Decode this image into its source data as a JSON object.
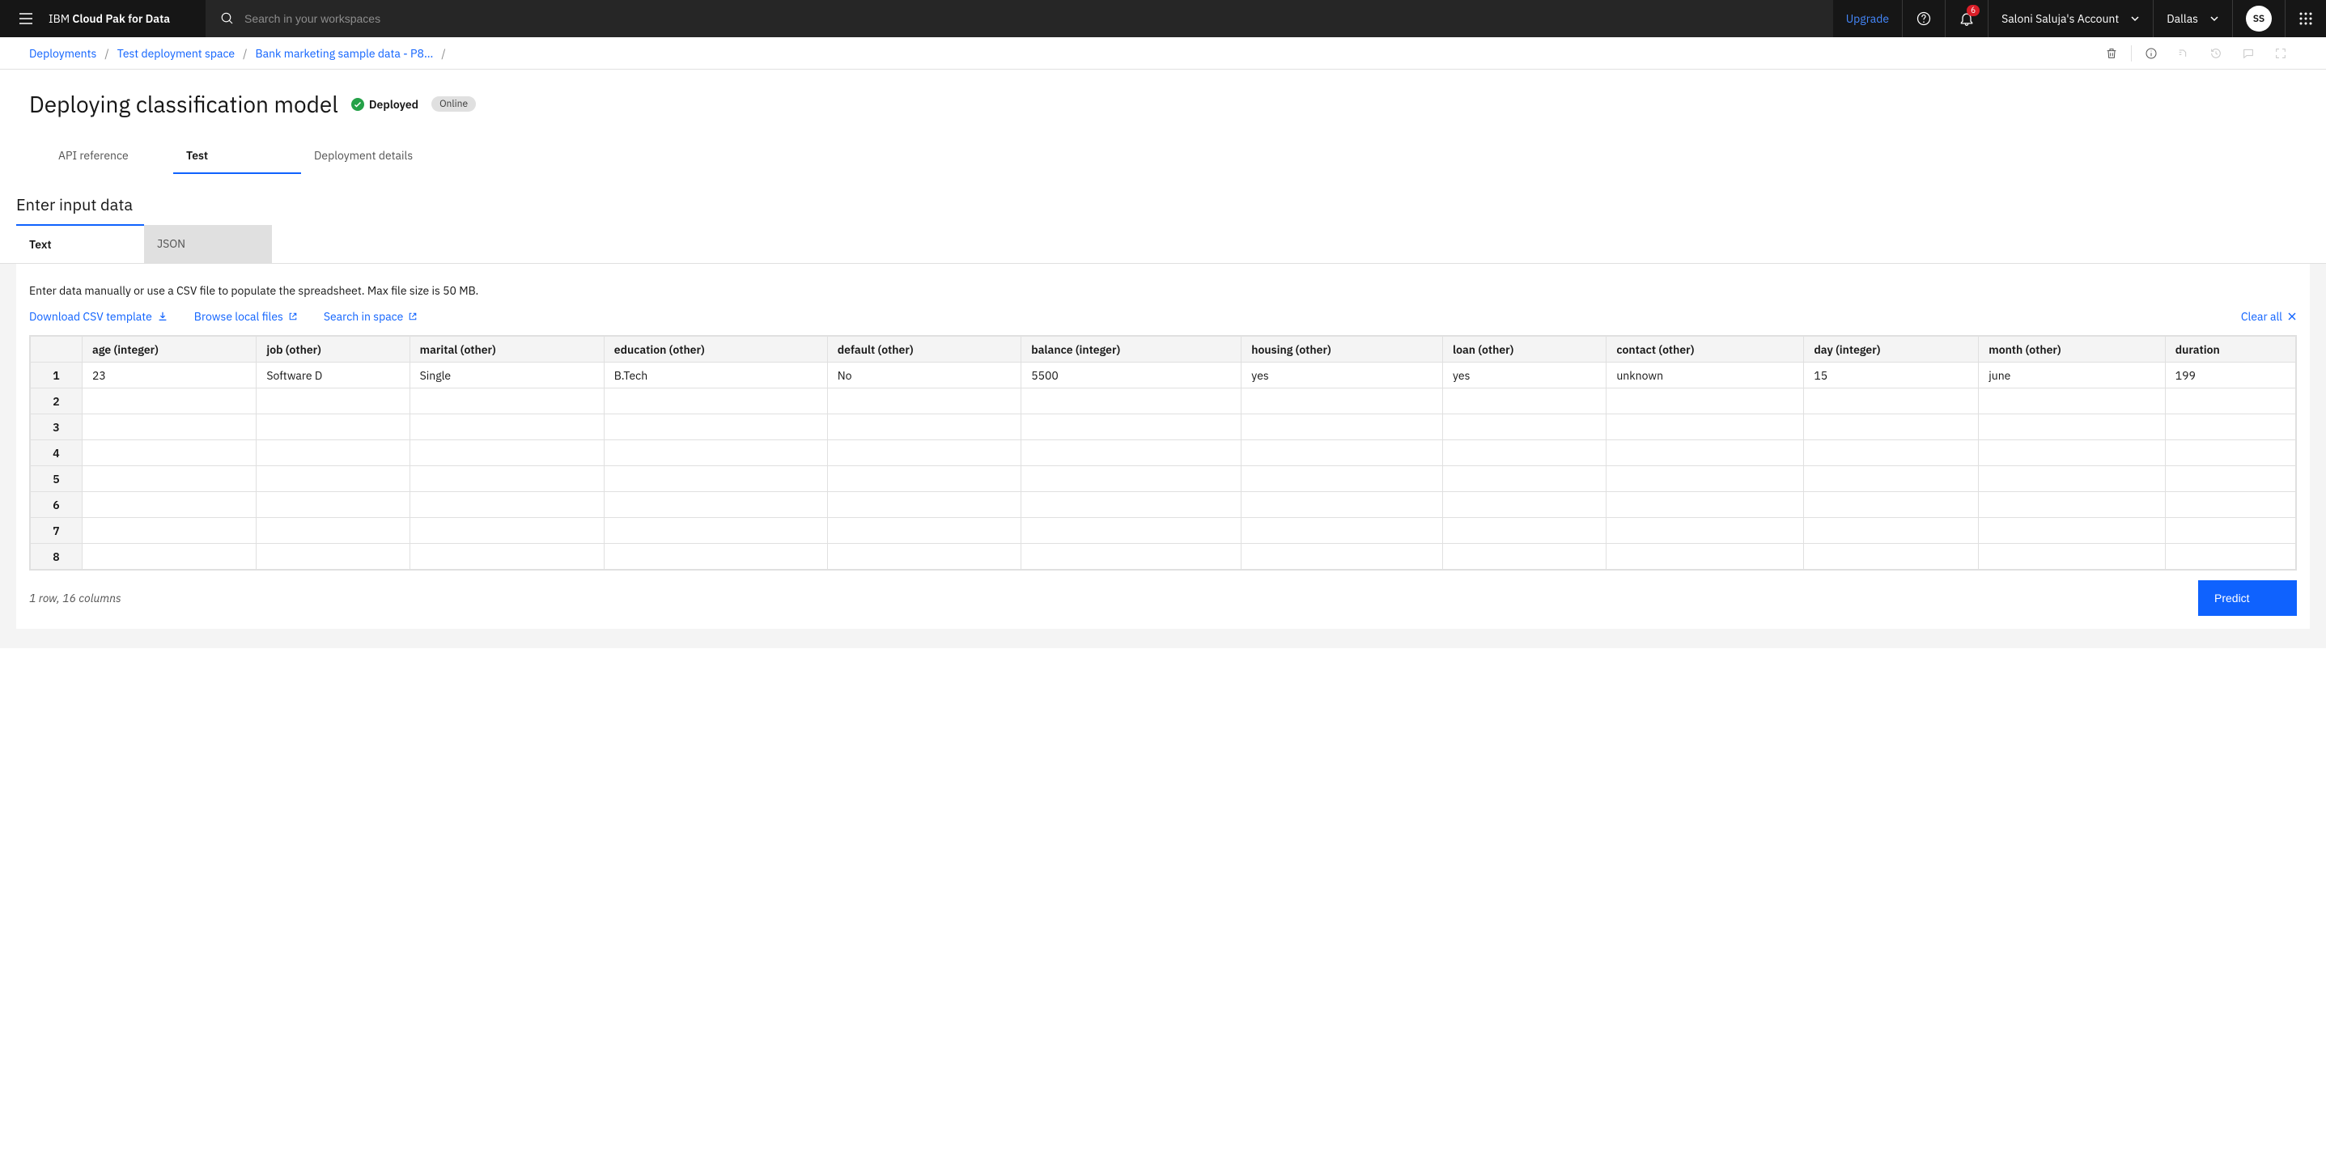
{
  "brand": {
    "prefix": "IBM ",
    "bold": "Cloud Pak for Data"
  },
  "search": {
    "placeholder": "Search in your workspaces"
  },
  "topbar": {
    "upgrade": "Upgrade",
    "notifications_count": "6",
    "account_label": "Saloni Saluja's Account",
    "region": "Dallas",
    "avatar_initials": "SS"
  },
  "breadcrumbs": [
    "Deployments",
    "Test deployment space",
    "Bank marketing sample data - P8..."
  ],
  "page": {
    "title": "Deploying classification model",
    "status": "Deployed",
    "badge": "Online"
  },
  "mainTabs": {
    "api": "API reference",
    "test": "Test",
    "details": "Deployment details"
  },
  "section_title": "Enter input data",
  "inputTabs": {
    "text": "Text",
    "json": "JSON"
  },
  "instruction": "Enter data manually or use a CSV file to populate the spreadsheet. Max file size is 50 MB.",
  "links": {
    "download": "Download CSV template",
    "browse": "Browse local files",
    "search_space": "Search in space",
    "clear_all": "Clear all"
  },
  "columns": [
    "age (integer)",
    "job (other)",
    "marital (other)",
    "education (other)",
    "default (other)",
    "balance (integer)",
    "housing (other)",
    "loan (other)",
    "contact (other)",
    "day (integer)",
    "month (other)",
    "duration"
  ],
  "rows": [
    {
      "n": "1",
      "c": [
        "23",
        "Software D",
        "Single",
        "B.Tech",
        "No",
        "5500",
        "yes",
        "yes",
        "unknown",
        "15",
        "june",
        "199"
      ]
    },
    {
      "n": "2",
      "c": [
        "",
        "",
        "",
        "",
        "",
        "",
        "",
        "",
        "",
        "",
        "",
        ""
      ]
    },
    {
      "n": "3",
      "c": [
        "",
        "",
        "",
        "",
        "",
        "",
        "",
        "",
        "",
        "",
        "",
        ""
      ]
    },
    {
      "n": "4",
      "c": [
        "",
        "",
        "",
        "",
        "",
        "",
        "",
        "",
        "",
        "",
        "",
        ""
      ]
    },
    {
      "n": "5",
      "c": [
        "",
        "",
        "",
        "",
        "",
        "",
        "",
        "",
        "",
        "",
        "",
        ""
      ]
    },
    {
      "n": "6",
      "c": [
        "",
        "",
        "",
        "",
        "",
        "",
        "",
        "",
        "",
        "",
        "",
        ""
      ]
    },
    {
      "n": "7",
      "c": [
        "",
        "",
        "",
        "",
        "",
        "",
        "",
        "",
        "",
        "",
        "",
        ""
      ]
    },
    {
      "n": "8",
      "c": [
        "",
        "",
        "",
        "",
        "",
        "",
        "",
        "",
        "",
        "",
        "",
        ""
      ]
    }
  ],
  "footer_text": "1 row, 16 columns",
  "predict": "Predict"
}
